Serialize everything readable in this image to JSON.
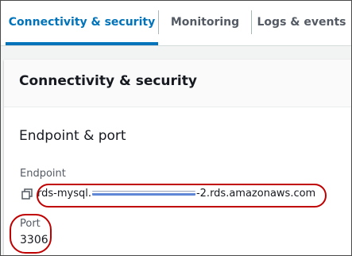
{
  "tabs": [
    {
      "label": "Connectivity & security",
      "active": true
    },
    {
      "label": "Monitoring",
      "active": false
    },
    {
      "label": "Logs & events",
      "active": false
    }
  ],
  "panel": {
    "title": "Connectivity & security",
    "section_title": "Endpoint & port",
    "endpoint_label": "Endpoint",
    "endpoint_prefix": "rds-mysql.",
    "endpoint_suffix": "-2.rds.amazonaws.com",
    "port_label": "Port",
    "port_value": "3306"
  },
  "icons": {
    "copy": "copy-icon"
  },
  "colors": {
    "active_tab": "#0073bb",
    "annotation": "#c00000"
  }
}
